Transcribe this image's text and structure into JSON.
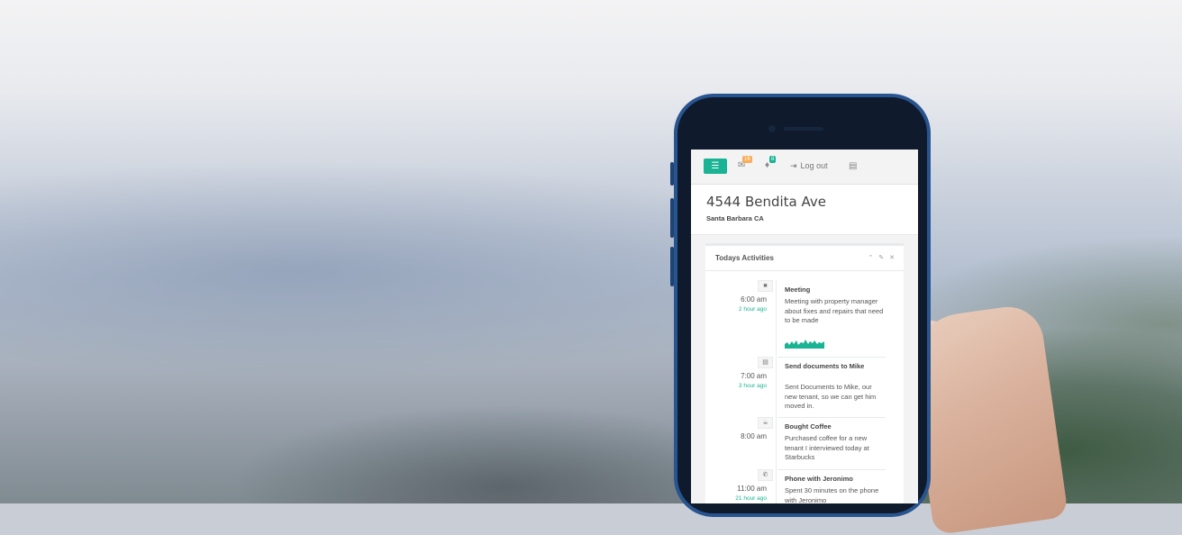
{
  "app": {
    "topbar": {
      "messages_count": "16",
      "alerts_count": "8",
      "logout_label": "Log out"
    },
    "property": {
      "address": "4544 Bendita Ave",
      "city": "Santa Barbara CA"
    },
    "activities_panel": {
      "title": "Todays Activities",
      "items": [
        {
          "icon": "briefcase-icon",
          "time": "6:00 am",
          "ago": "2 hour ago",
          "title": "Meeting",
          "desc": "Meeting with property manager about fixes and repairs that need to be made"
        },
        {
          "icon": "file-icon",
          "time": "7:00 am",
          "ago": "3 hour ago",
          "title": "Send documents to Mike",
          "desc": "Sent Documents to Mike, our new tenant, so we can get him moved in."
        },
        {
          "icon": "coffee-icon",
          "time": "8:00 am",
          "ago": "",
          "title": "Bought Coffee",
          "desc": "Purchased coffee for a new tenant I interviewed today at Starbucks"
        },
        {
          "icon": "phone-icon",
          "time": "11:00 am",
          "ago": "21 hour ago",
          "title": "Phone with Jeronimo",
          "desc": "Spent 30 minutes on the phone with Jeronimo"
        }
      ]
    },
    "colors": {
      "accent": "#1ab394",
      "badge_orange": "#f8ac59",
      "badge_green": "#1ab394",
      "phone_frame": "#28548f"
    }
  }
}
